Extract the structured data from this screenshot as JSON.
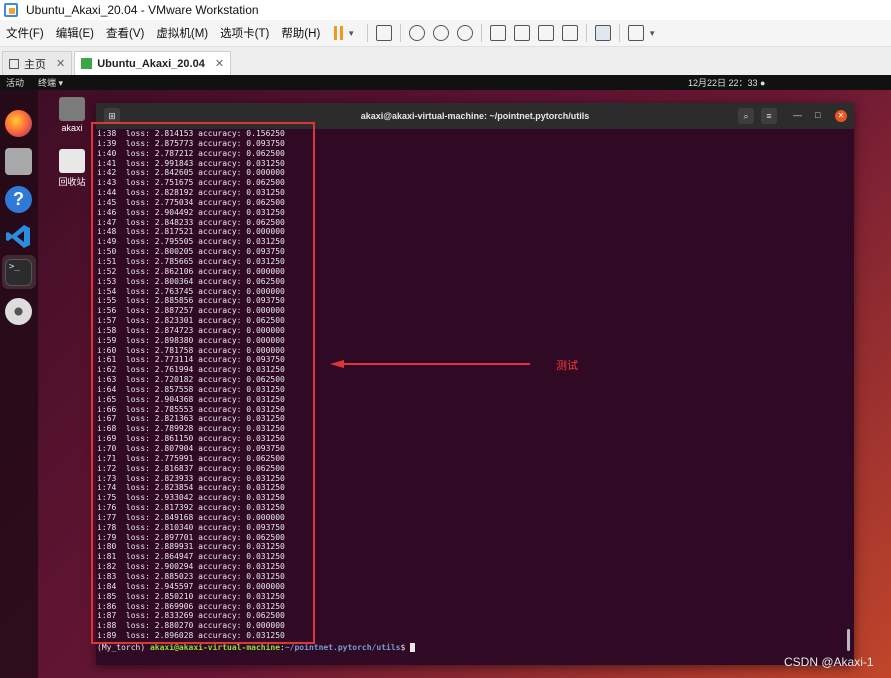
{
  "window": {
    "title": "Ubuntu_Akaxi_20.04 - VMware Workstation"
  },
  "menubar": {
    "items": [
      "文件(F)",
      "编辑(E)",
      "查看(V)",
      "虚拟机(M)",
      "选项卡(T)",
      "帮助(H)"
    ]
  },
  "tabs": [
    {
      "label": "主页"
    },
    {
      "label": "Ubuntu_Akaxi_20.04"
    }
  ],
  "ubuntu_topbar": {
    "activities": "活动",
    "app_menu": "终端 ▾",
    "clock": "12月22日  22：33"
  },
  "desktop_icons": [
    {
      "label": "akaxi"
    },
    {
      "label": "回收站"
    }
  ],
  "terminal": {
    "title": "akaxi@akaxi-virtual-machine: ~/pointnet.pytorch/utils",
    "lines": [
      "i:38  loss: 2.814153 accuracy: 0.156250",
      "i:39  loss: 2.875773 accuracy: 0.093750",
      "i:40  loss: 2.787212 accuracy: 0.062500",
      "i:41  loss: 2.991843 accuracy: 0.031250",
      "i:42  loss: 2.842605 accuracy: 0.000000",
      "i:43  loss: 2.751675 accuracy: 0.062500",
      "i:44  loss: 2.828192 accuracy: 0.031250",
      "i:45  loss: 2.775034 accuracy: 0.062500",
      "i:46  loss: 2.904492 accuracy: 0.031250",
      "i:47  loss: 2.848233 accuracy: 0.062500",
      "i:48  loss: 2.817521 accuracy: 0.000000",
      "i:49  loss: 2.795505 accuracy: 0.031250",
      "i:50  loss: 2.800205 accuracy: 0.093750",
      "i:51  loss: 2.785665 accuracy: 0.031250",
      "i:52  loss: 2.862106 accuracy: 0.000000",
      "i:53  loss: 2.800364 accuracy: 0.062500",
      "i:54  loss: 2.763745 accuracy: 0.000000",
      "i:55  loss: 2.885856 accuracy: 0.093750",
      "i:56  loss: 2.887257 accuracy: 0.000000",
      "i:57  loss: 2.823301 accuracy: 0.062500",
      "i:58  loss: 2.874723 accuracy: 0.000000",
      "i:59  loss: 2.898380 accuracy: 0.000000",
      "i:60  loss: 2.781758 accuracy: 0.000000",
      "i:61  loss: 2.773114 accuracy: 0.093750",
      "i:62  loss: 2.761994 accuracy: 0.031250",
      "i:63  loss: 2.720182 accuracy: 0.062500",
      "i:64  loss: 2.857558 accuracy: 0.031250",
      "i:65  loss: 2.904368 accuracy: 0.031250",
      "i:66  loss: 2.785553 accuracy: 0.031250",
      "i:67  loss: 2.821363 accuracy: 0.031250",
      "i:68  loss: 2.789928 accuracy: 0.031250",
      "i:69  loss: 2.861150 accuracy: 0.031250",
      "i:70  loss: 2.807904 accuracy: 0.093750",
      "i:71  loss: 2.775991 accuracy: 0.062500",
      "i:72  loss: 2.816837 accuracy: 0.062500",
      "i:73  loss: 2.823933 accuracy: 0.031250",
      "i:74  loss: 2.823854 accuracy: 0.031250",
      "i:75  loss: 2.933042 accuracy: 0.031250",
      "i:76  loss: 2.817392 accuracy: 0.031250",
      "i:77  loss: 2.849168 accuracy: 0.000000",
      "i:78  loss: 2.810340 accuracy: 0.093750",
      "i:79  loss: 2.897701 accuracy: 0.062500",
      "i:80  loss: 2.889931 accuracy: 0.031250",
      "i:81  loss: 2.864947 accuracy: 0.031250",
      "i:82  loss: 2.900294 accuracy: 0.031250",
      "i:83  loss: 2.885023 accuracy: 0.031250",
      "i:84  loss: 2.945597 accuracy: 0.000000",
      "i:85  loss: 2.850210 accuracy: 0.031250",
      "i:86  loss: 2.869906 accuracy: 0.031250",
      "i:87  loss: 2.833269 accuracy: 0.062500",
      "i:88  loss: 2.880270 accuracy: 0.000000",
      "i:89  loss: 2.896028 accuracy: 0.031250"
    ],
    "prompt": {
      "env": "(My_torch) ",
      "userhost": "akaxi@akaxi-virtual-machine",
      "colon": ":",
      "path": "~/pointnet.pytorch/utils",
      "symbol": "$ "
    }
  },
  "annotation": {
    "label": "测试"
  },
  "watermark": "CSDN @Akaxi-1",
  "colors": {
    "highlight": "#e0333a",
    "terminal_bg": "#300a24",
    "ubuntu_orange": "#e95420"
  }
}
